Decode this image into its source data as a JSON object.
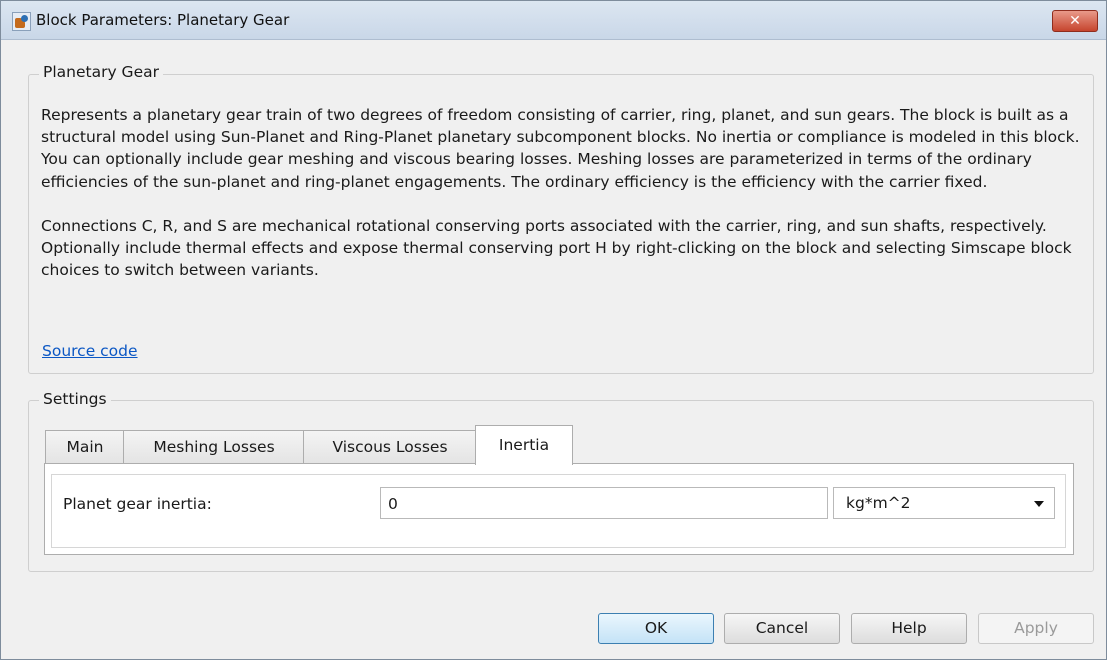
{
  "window": {
    "title": "Block Parameters: Planetary Gear",
    "close_label": "✕"
  },
  "description_group": {
    "label": "Planetary Gear",
    "paragraphs": [
      "Represents a planetary gear train of two degrees of freedom consisting of carrier, ring, planet, and sun gears. The block is built as a structural model using Sun-Planet and Ring-Planet planetary subcomponent blocks. No inertia or compliance is modeled in this block. You can optionally include gear meshing and viscous bearing losses. Meshing losses are parameterized in terms of the ordinary efficiencies of the sun-planet and ring-planet engagements. The ordinary efficiency is the efficiency with the carrier fixed.",
      "Connections C, R, and S are mechanical rotational conserving ports associated with the carrier, ring, and sun shafts, respectively. Optionally include thermal effects and expose thermal conserving port H by right-clicking on the block and selecting Simscape block choices to switch between variants."
    ],
    "link": "Source code"
  },
  "settings_group": {
    "label": "Settings",
    "tabs": [
      {
        "label": "Main"
      },
      {
        "label": "Meshing Losses"
      },
      {
        "label": "Viscous Losses"
      },
      {
        "label": "Inertia"
      }
    ],
    "active_tab": "Inertia",
    "fields": {
      "planet_inertia": {
        "label": "Planet gear inertia:",
        "value": "0",
        "unit": "kg*m^2"
      }
    }
  },
  "buttons": {
    "ok": "OK",
    "cancel": "Cancel",
    "help": "Help",
    "apply": "Apply"
  }
}
